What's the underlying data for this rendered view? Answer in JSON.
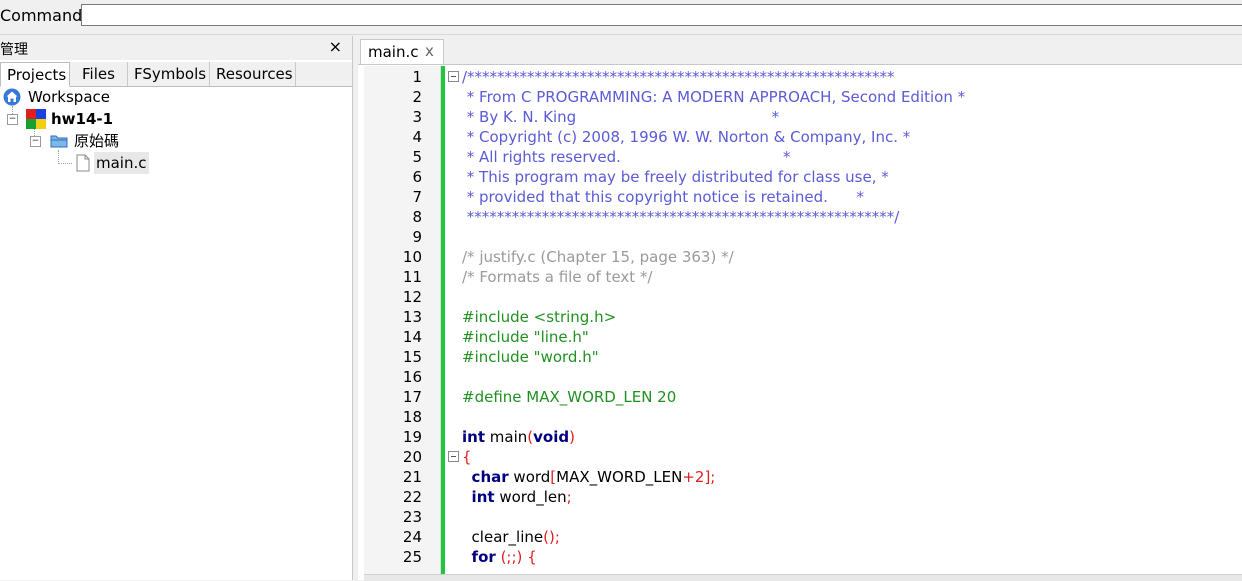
{
  "command": {
    "label": "Command:",
    "value": ""
  },
  "panel": {
    "title": "管理",
    "close": "×",
    "tabs": [
      "Projects",
      "Files",
      "FSymbols",
      "Resources"
    ],
    "tree": {
      "workspace": "Workspace",
      "project": "hw14-1",
      "folder": "原始碼",
      "file": "main.c"
    }
  },
  "editor": {
    "tab": {
      "label": "main.c",
      "close": "x"
    },
    "lines": [
      {
        "n": "1",
        "t": "/*********************************************************",
        "c": "cblock",
        "fold": true
      },
      {
        "n": "2",
        "t": " * From C PROGRAMMING: A MODERN APPROACH, Second Edition *",
        "c": "cblock"
      },
      {
        "n": "3",
        "t": " * By K. N. King                                         *",
        "c": "cblock"
      },
      {
        "n": "4",
        "t": " * Copyright (c) 2008, 1996 W. W. Norton & Company, Inc. *",
        "c": "cblock"
      },
      {
        "n": "5",
        "t": " * All rights reserved.                                  *",
        "c": "cblock"
      },
      {
        "n": "6",
        "t": " * This program may be freely distributed for class use, *",
        "c": "cblock"
      },
      {
        "n": "7",
        "t": " * provided that this copyright notice is retained.      *",
        "c": "cblock"
      },
      {
        "n": "8",
        "t": " *********************************************************/",
        "c": "cblock"
      },
      {
        "n": "9",
        "t": "",
        "c": "plain"
      },
      {
        "n": "10",
        "t": "/* justify.c (Chapter 15, page 363) */",
        "c": "cline"
      },
      {
        "n": "11",
        "t": "/* Formats a file of text */",
        "c": "cline"
      },
      {
        "n": "12",
        "t": "",
        "c": "plain"
      },
      {
        "n": "13",
        "t": "#include <string.h>",
        "c": "pre"
      },
      {
        "n": "14",
        "t": "#include \"line.h\"",
        "c": "pre"
      },
      {
        "n": "15",
        "t": "#include \"word.h\"",
        "c": "pre"
      },
      {
        "n": "16",
        "t": "",
        "c": "plain"
      },
      {
        "n": "17",
        "t": "#define MAX_WORD_LEN 20",
        "c": "pre"
      },
      {
        "n": "18",
        "t": "",
        "c": "plain"
      },
      {
        "n": "19",
        "t": "int main(void)",
        "c": "plain"
      },
      {
        "n": "20",
        "t": "{",
        "c": "num",
        "fold": true
      },
      {
        "n": "21",
        "t": "  char word[MAX_WORD_LEN+2];",
        "c": "plain"
      },
      {
        "n": "22",
        "t": "  int word_len;",
        "c": "plain"
      },
      {
        "n": "23",
        "t": "",
        "c": "plain"
      },
      {
        "n": "24",
        "t": "  clear_line();",
        "c": "plain"
      },
      {
        "n": "25",
        "t": "  for (;;) {",
        "c": "plain"
      }
    ]
  }
}
